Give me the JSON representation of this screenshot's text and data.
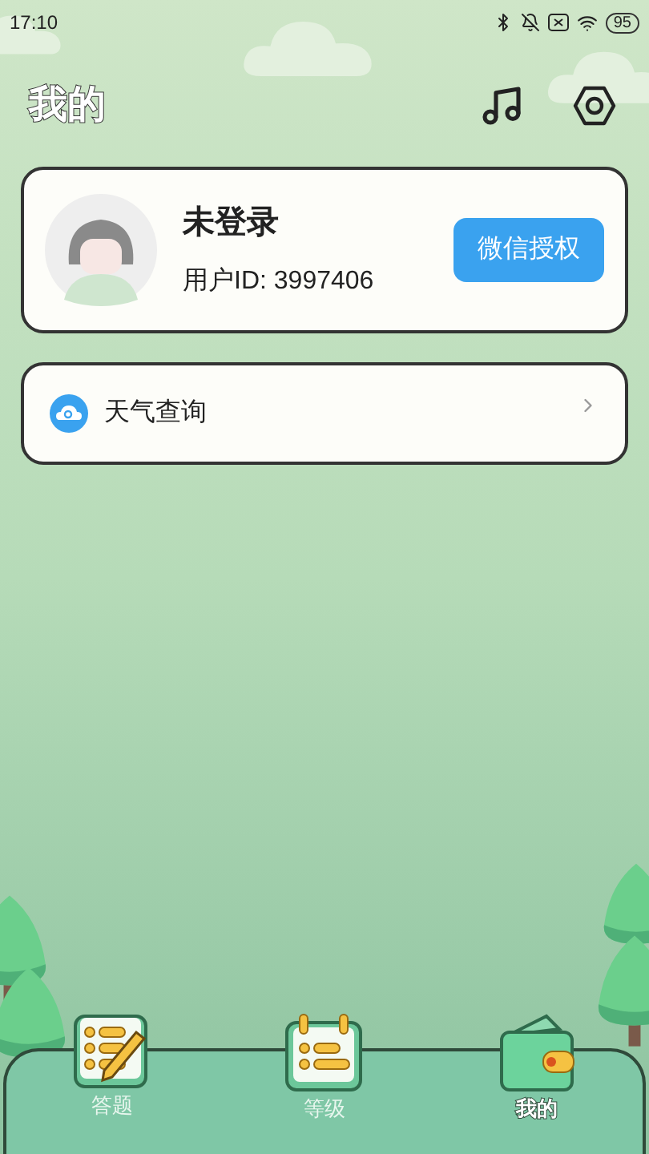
{
  "status_bar": {
    "time": "17:10",
    "battery": "95"
  },
  "header": {
    "title": "我的"
  },
  "profile": {
    "name": "未登录",
    "user_id": "用户ID: 3997406",
    "button": "微信授权"
  },
  "menu": [
    {
      "label": "天气查询"
    }
  ],
  "tab_bar": [
    {
      "label": "答题",
      "kind": "quiz",
      "selected": false
    },
    {
      "label": "等级",
      "kind": "level",
      "selected": false
    },
    {
      "label": "我的",
      "kind": "wallet",
      "selected": true
    }
  ]
}
